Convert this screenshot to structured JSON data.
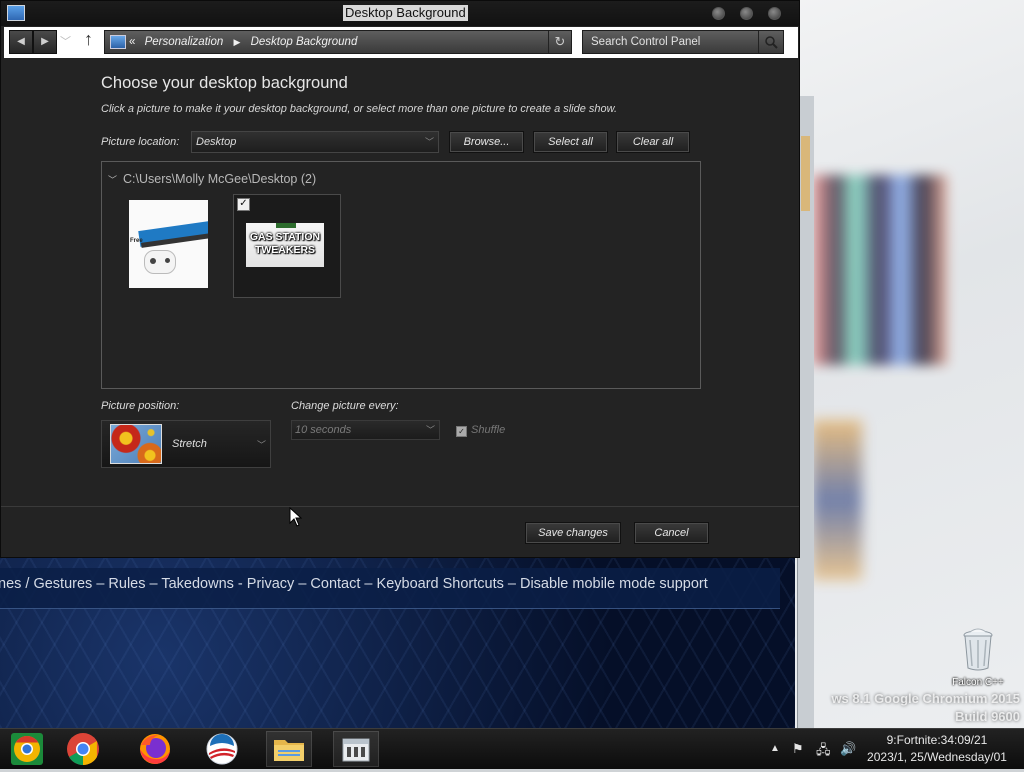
{
  "window": {
    "title": "Desktop Background"
  },
  "navigation": {
    "breadcrumb_prefix": "«",
    "breadcrumb": [
      "Personalization",
      "Desktop Background"
    ],
    "search_placeholder": "Search Control Panel"
  },
  "page": {
    "heading": "Choose your desktop background",
    "subtext": "Click a picture to make it your desktop background, or select more than one picture to create a slide show.",
    "picture_location_label": "Picture location:",
    "picture_location_value": "Desktop",
    "browse_label": "Browse...",
    "select_all_label": "Select all",
    "clear_all_label": "Clear all",
    "group_header": "C:\\Users\\Molly McGee\\Desktop (2)",
    "pictures": [
      {
        "caption": "",
        "selected": false,
        "icon": "controller-image",
        "text": "Free"
      },
      {
        "caption": "GAS STATION TWEAKERS",
        "selected": true,
        "icon": "meme-image"
      }
    ],
    "picture_position_label": "Picture position:",
    "picture_position_value": "Stretch",
    "change_picture_label": "Change picture every:",
    "change_picture_value": "10 seconds",
    "shuffle_label": "Shuffle",
    "save_label": "Save changes",
    "cancel_label": "Cancel"
  },
  "background_webpage": {
    "footer_links": "nes / Gestures – Rules – Takedowns - Privacy – Contact – Keyboard Shortcuts – Disable mobile mode support"
  },
  "desktop": {
    "recycle_bin_label": "Falcon C++",
    "watermark_line1": "ws 8.1 Google Chromium 2015",
    "watermark_line2": "Build 9600"
  },
  "taskbar": {
    "apps": [
      "chrome-canary-icon",
      "chrome-icon",
      "firefox-icon",
      "obama-logo-icon",
      "file-explorer-icon",
      "control-panel-icon"
    ],
    "clock_line1": "9:Fortnite:34:09/21",
    "clock_line2": "2023/1, 25/Wednesday/01"
  },
  "colors": {
    "window_bg": "#232323",
    "titlebar_bg": "#141414",
    "accent_blue": "#1f7ac4"
  }
}
